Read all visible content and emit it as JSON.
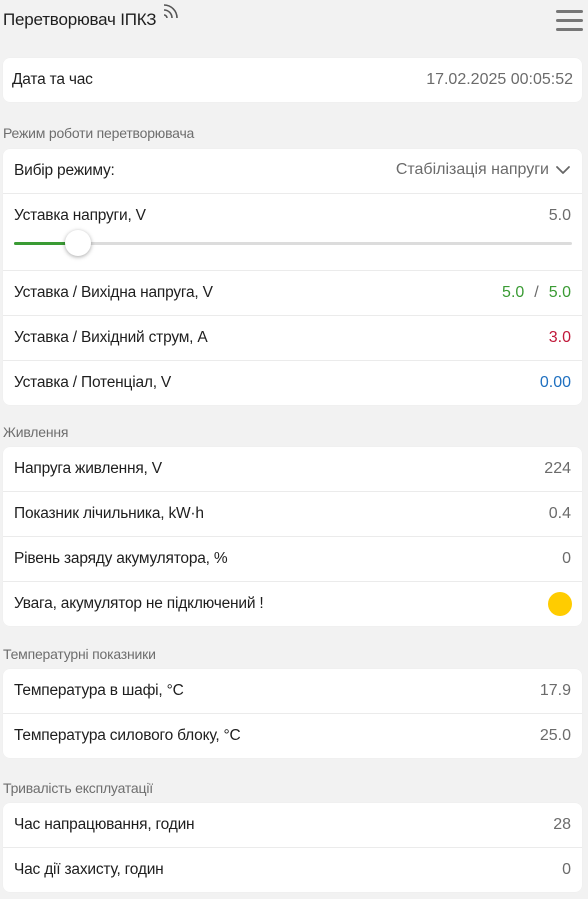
{
  "header": {
    "title": "Перетворювач ІПКЗ",
    "signal_icon": "wifi-signal-icon",
    "menu_icon": "hamburger-menu-icon"
  },
  "datetime": {
    "label": "Дата та час",
    "value": "17.02.2025 00:05:52"
  },
  "mode_section": {
    "title": "Режим роботи перетворювача",
    "mode_label": "Вибір режиму:",
    "mode_value": "Стабілізація напруги",
    "setpoint_label": "Уставка напруги, V",
    "setpoint_value": "5.0",
    "slider_fraction": 0.115,
    "voltage_label": "Уставка / Вихідна напруга, V",
    "voltage_set": "5.0",
    "voltage_sep": "/",
    "voltage_out": "5.0",
    "current_label": "Уставка / Вихідний струм, A",
    "current_value": "3.0",
    "potential_label": "Уставка / Потенціал, V",
    "potential_value": "0.00"
  },
  "power_section": {
    "title": "Живлення",
    "rows": [
      {
        "label": "Напруга живлення, V",
        "value": "224"
      },
      {
        "label": "Показник лічильника, kW·h",
        "value": "0.4"
      },
      {
        "label": "Рівень заряду акумулятора, %",
        "value": "0"
      }
    ],
    "warning_label": "Увага, акумулятор не підключений !"
  },
  "temp_section": {
    "title": "Температурні показники",
    "rows": [
      {
        "label": "Температура в шафі, °C",
        "value": "17.9"
      },
      {
        "label": "Температура силового блоку, °C",
        "value": "25.0"
      }
    ]
  },
  "uptime_section": {
    "title": "Тривалість експлуатації",
    "rows": [
      {
        "label": "Час напрацювання, годин",
        "value": "28"
      },
      {
        "label": "Час дії захисту, годин",
        "value": "0"
      }
    ]
  },
  "colors": {
    "green": "#3a9b34",
    "red": "#c0193a",
    "blue": "#1f70c0",
    "warning": "#ffcc00"
  }
}
